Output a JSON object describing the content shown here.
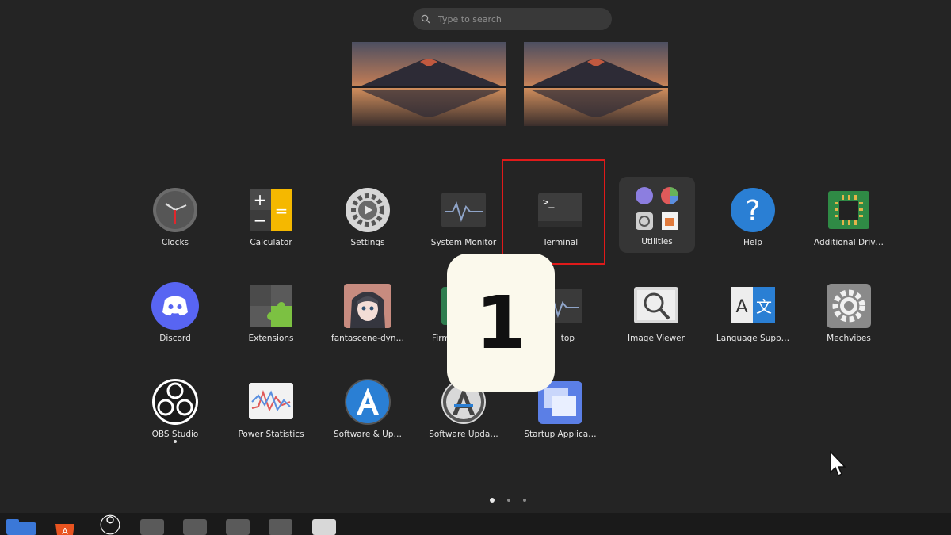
{
  "search": {
    "placeholder": "Type to search"
  },
  "workspaces": [
    {
      "name": "workspace-1"
    },
    {
      "name": "workspace-2"
    }
  ],
  "apps": [
    {
      "label": "Clocks",
      "icon": "clock-icon"
    },
    {
      "label": "Calculator",
      "icon": "calculator-icon"
    },
    {
      "label": "Settings",
      "icon": "gear-icon"
    },
    {
      "label": "System Monitor",
      "icon": "system-monitor-icon"
    },
    {
      "label": "Terminal",
      "icon": "terminal-icon"
    },
    {
      "label": "Utilities",
      "icon": "folder-icon"
    },
    {
      "label": "Help",
      "icon": "help-icon"
    },
    {
      "label": "Additional Driv…",
      "icon": "chip-icon"
    },
    {
      "label": "Discord",
      "icon": "discord-icon"
    },
    {
      "label": "Extensions",
      "icon": "puzzle-icon"
    },
    {
      "label": "fantascene-dyn…",
      "icon": "anime-wallpaper-icon"
    },
    {
      "label": "Firm",
      "icon": "firmware-icon"
    },
    {
      "label": "top",
      "icon": "resources-icon"
    },
    {
      "label": "Image Viewer",
      "icon": "image-viewer-icon"
    },
    {
      "label": "Language Supp…",
      "icon": "language-icon"
    },
    {
      "label": "Mechvibes",
      "icon": "mechvibes-gear-icon"
    },
    {
      "label": "OBS Studio",
      "icon": "obs-icon"
    },
    {
      "label": "Power Statistics",
      "icon": "power-stats-icon"
    },
    {
      "label": "Software & Up…",
      "icon": "software-sources-icon"
    },
    {
      "label": "Software Upda…",
      "icon": "software-updater-icon"
    },
    {
      "label": "Startup Applica…",
      "icon": "startup-apps-icon"
    }
  ],
  "overlay_badge": "1",
  "pager": {
    "pages": 3,
    "current": 1
  },
  "dock": [
    {
      "icon": "files-icon"
    },
    {
      "icon": "app-center-icon"
    },
    {
      "icon": "obs-icon"
    },
    {
      "icon": "generic-app-icon"
    },
    {
      "icon": "generic-app-icon"
    },
    {
      "icon": "generic-app-icon"
    },
    {
      "icon": "generic-app-icon"
    },
    {
      "icon": "generic-app-icon"
    }
  ],
  "colors": {
    "background": "#242424",
    "highlight": "#e01a1a",
    "badge_bg": "#fbf9ec"
  }
}
